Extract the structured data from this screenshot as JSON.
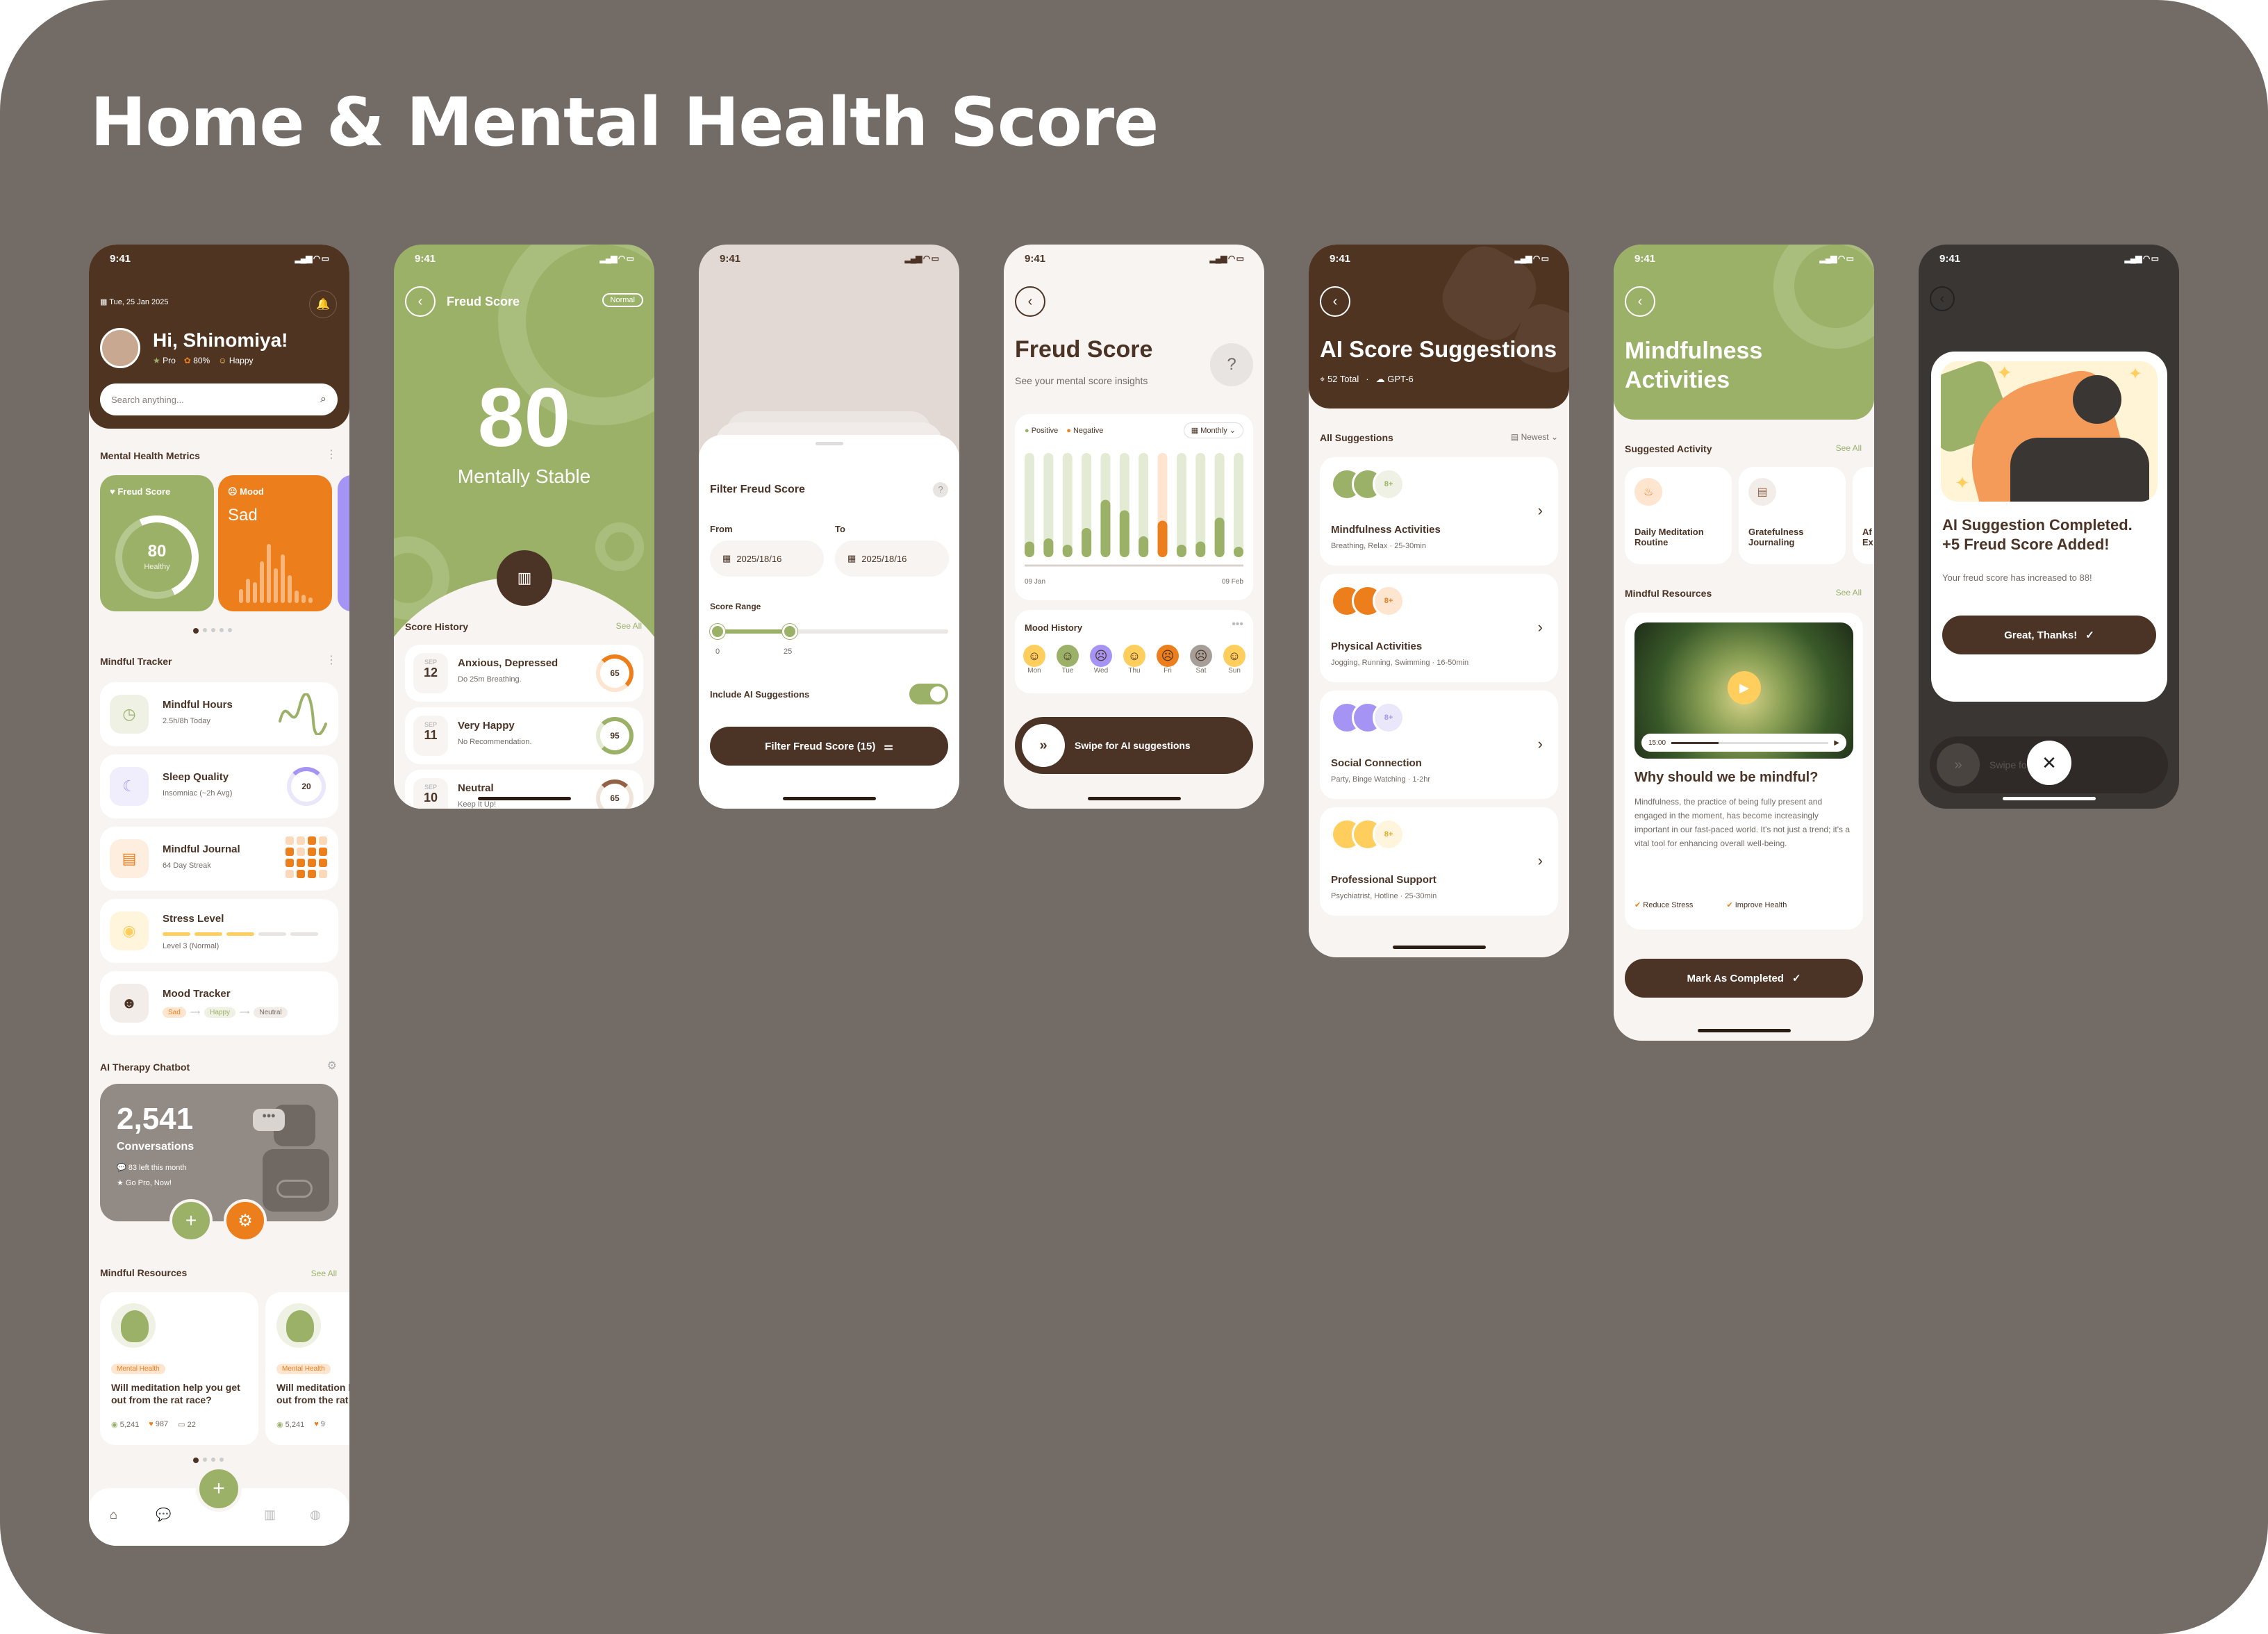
{
  "title": "Home & Mental Health Score",
  "status_time": "9:41",
  "colors": {
    "brown": "#4b3425",
    "green": "#9bb168",
    "orange": "#ed7e1c",
    "yellow": "#ffce5c",
    "purple": "#a694f5",
    "cream": "#f7f4f2"
  },
  "home": {
    "date": "Tue, 25 Jan 2025",
    "greeting": "Hi, Shinomiya!",
    "badges": [
      "Pro",
      "80%",
      "Happy"
    ],
    "search_placeholder": "Search anything...",
    "metrics_title": "Mental Health Metrics",
    "freud_label": "Freud Score",
    "freud_value": "80",
    "freud_status": "Healthy",
    "mood_label": "Mood",
    "mood_value": "Sad",
    "tracker_title": "Mindful Tracker",
    "trackers": [
      {
        "title": "Mindful Hours",
        "sub": "2.5h/8h Today"
      },
      {
        "title": "Sleep Quality",
        "sub": "Insomniac (~2h Avg)",
        "value": "20"
      },
      {
        "title": "Mindful Journal",
        "sub": "64 Day Streak"
      },
      {
        "title": "Stress Level",
        "sub": "Level 3 (Normal)"
      },
      {
        "title": "Mood Tracker",
        "chips": [
          "Sad",
          "Happy",
          "Neutral"
        ]
      }
    ],
    "chatbot_title": "AI Therapy Chatbot",
    "chat_count": "2,541",
    "chat_label": "Conversations",
    "chat_left": "83 left this month",
    "chat_pro": "Go Pro, Now!",
    "resources_title": "Mindful Resources",
    "see_all": "See All",
    "articles": [
      {
        "tag": "Mental Health",
        "title": "Will meditation help you get out from the rat race?",
        "views": "5,241",
        "likes": "987",
        "comments": "22"
      },
      {
        "tag": "Mental Health",
        "title": "Will meditation help you get out from the rat race?",
        "views": "5,241",
        "likes": "9"
      }
    ]
  },
  "freud": {
    "title": "Freud Score",
    "badge": "Normal",
    "score": "80",
    "status": "Mentally Stable",
    "history_title": "Score History",
    "see_all": "See All",
    "history": [
      {
        "month": "SEP",
        "day": "12",
        "title": "Anxious, Depressed",
        "sub": "Do 25m Breathing.",
        "score": "65"
      },
      {
        "month": "SEP",
        "day": "11",
        "title": "Very Happy",
        "sub": "No Recommendation.",
        "score": "95"
      },
      {
        "month": "SEP",
        "day": "10",
        "title": "Neutral",
        "sub": "Keep It Up!",
        "score": "65"
      }
    ]
  },
  "filter": {
    "title": "Filter Freud Score",
    "from_label": "From",
    "to_label": "To",
    "from": "2025/18/16",
    "to": "2025/18/16",
    "range_label": "Score Range",
    "range_min": "0",
    "range_max": "25",
    "ai_label": "Include AI Suggestions",
    "button": "Filter Freud Score (15)"
  },
  "insights": {
    "title": "Freud Score",
    "subtitle": "See your mental score insights",
    "legend": [
      "Positive",
      "Negative"
    ],
    "period": "Monthly",
    "x_start": "09 Jan",
    "x_end": "09 Feb",
    "mood_title": "Mood History",
    "days": [
      "Mon",
      "Tue",
      "Wed",
      "Thu",
      "Fri",
      "Sat",
      "Sun"
    ],
    "swipe": "Swipe for AI suggestions"
  },
  "chart_data": {
    "type": "bar",
    "series": [
      {
        "name": "Positive",
        "values": [
          0.15,
          0.18,
          0.12,
          0.28,
          0.55,
          0.45,
          0.2,
          0.3,
          0.12,
          0.15,
          0.38,
          0.1
        ]
      },
      {
        "name": "Negative",
        "values": [
          0,
          0,
          0,
          0,
          0,
          0,
          0,
          0.35,
          0,
          0,
          0,
          0
        ]
      }
    ],
    "x_labels": [
      "09 Jan",
      "09 Feb"
    ]
  },
  "ai": {
    "title": "AI Score Suggestions",
    "total": "52 Total",
    "model": "GPT-6",
    "list_title": "All Suggestions",
    "sort": "Newest",
    "items": [
      {
        "title": "Mindfulness Activities",
        "sub": "Breathing, Relax",
        "dur": "25-30min"
      },
      {
        "title": "Physical Activities",
        "sub": "Jogging, Running, Swimming",
        "dur": "16-50min"
      },
      {
        "title": "Social Connection",
        "sub": "Party, Binge Watching",
        "dur": "1-2hr"
      },
      {
        "title": "Professional Support",
        "sub": "Psychiatrist, Hotline",
        "dur": "25-30min"
      }
    ],
    "more": "8+"
  },
  "mind": {
    "title": "Mindfulness Activities",
    "suggested_title": "Suggested Activity",
    "see_all": "See All",
    "activities": [
      "Daily Meditation Routine",
      "Gratefulness Journaling",
      "Af Ex"
    ],
    "resources_title": "Mindful Resources",
    "video_time": "15:00",
    "heading": "Why should we be mindful?",
    "body": "Mindfulness, the practice of being fully present and engaged in the moment, has become increasingly important in our fast-paced world. It's not just a trend; it's a vital tool for enhancing overall well-being.",
    "tags": [
      "Reduce Stress",
      "Improve Health"
    ],
    "button": "Mark As Completed"
  },
  "done": {
    "title": "AI Suggestion Completed. +5 Freud Score Added!",
    "sub": "Your freud score has increased to 88!",
    "button": "Great, Thanks!",
    "bg_text": "Swipe fo      ections"
  }
}
